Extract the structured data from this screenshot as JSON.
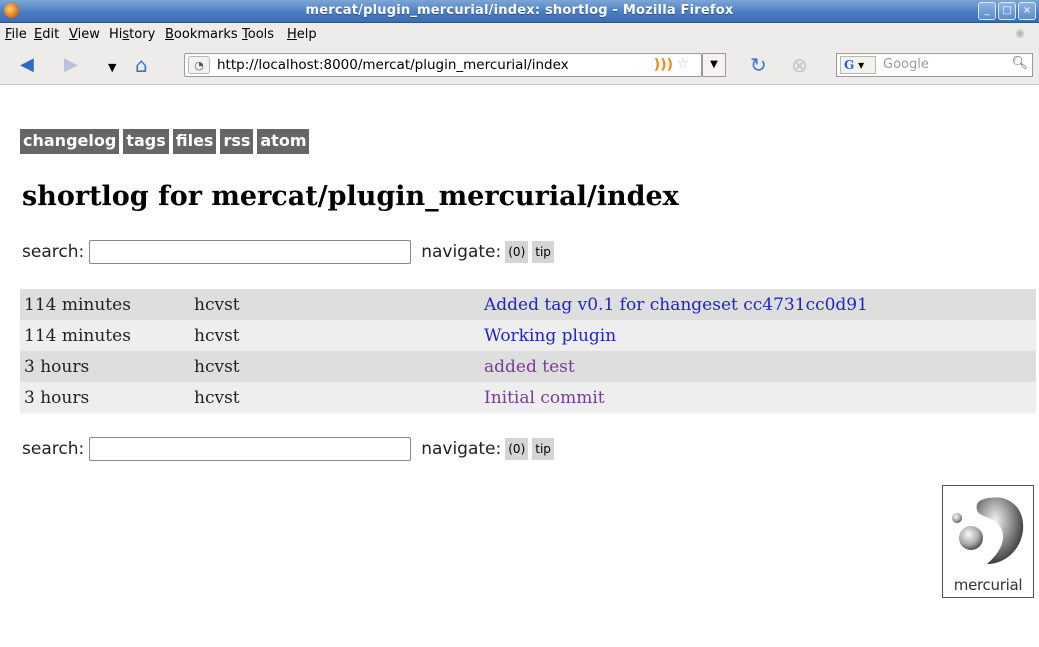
{
  "window": {
    "title": "mercat/plugin_mercurial/index: shortlog - Mozilla Firefox",
    "buttons": [
      "_",
      "□",
      "×"
    ]
  },
  "menubar": {
    "items": [
      "File",
      "Edit",
      "View",
      "History",
      "Bookmarks",
      "Tools",
      "Help"
    ],
    "access_keys": [
      "F",
      "E",
      "V",
      "s",
      "B",
      "T",
      "H"
    ]
  },
  "navbar": {
    "url": "http://localhost:8000/mercat/plugin_mercurial/index",
    "search_placeholder": "Google",
    "search_engine_letter": "G"
  },
  "page": {
    "tabs": [
      "changelog",
      "tags",
      "files",
      "rss",
      "atom"
    ],
    "heading": "shortlog for mercat/plugin_mercurial/index",
    "search_label": "search:",
    "search_value": "",
    "navigate_label": "navigate:",
    "nav_buttons": [
      "(0)",
      "tip"
    ],
    "log": [
      {
        "age": "114 minutes",
        "author": "hcvst",
        "description": "Added tag v0.1 for changeset cc4731cc0d91",
        "visited": false
      },
      {
        "age": "114 minutes",
        "author": "hcvst",
        "description": "Working plugin",
        "visited": false
      },
      {
        "age": "3 hours",
        "author": "hcvst",
        "description": "added test",
        "visited": true
      },
      {
        "age": "3 hours",
        "author": "hcvst",
        "description": "Initial commit",
        "visited": true
      }
    ],
    "logo_text": "mercurial"
  },
  "colors": {
    "tab_bg": "#666666",
    "link": "#2323cc",
    "visited_link": "#7a3a9a",
    "row_odd": "#dedede",
    "row_even": "#eeeeee"
  }
}
